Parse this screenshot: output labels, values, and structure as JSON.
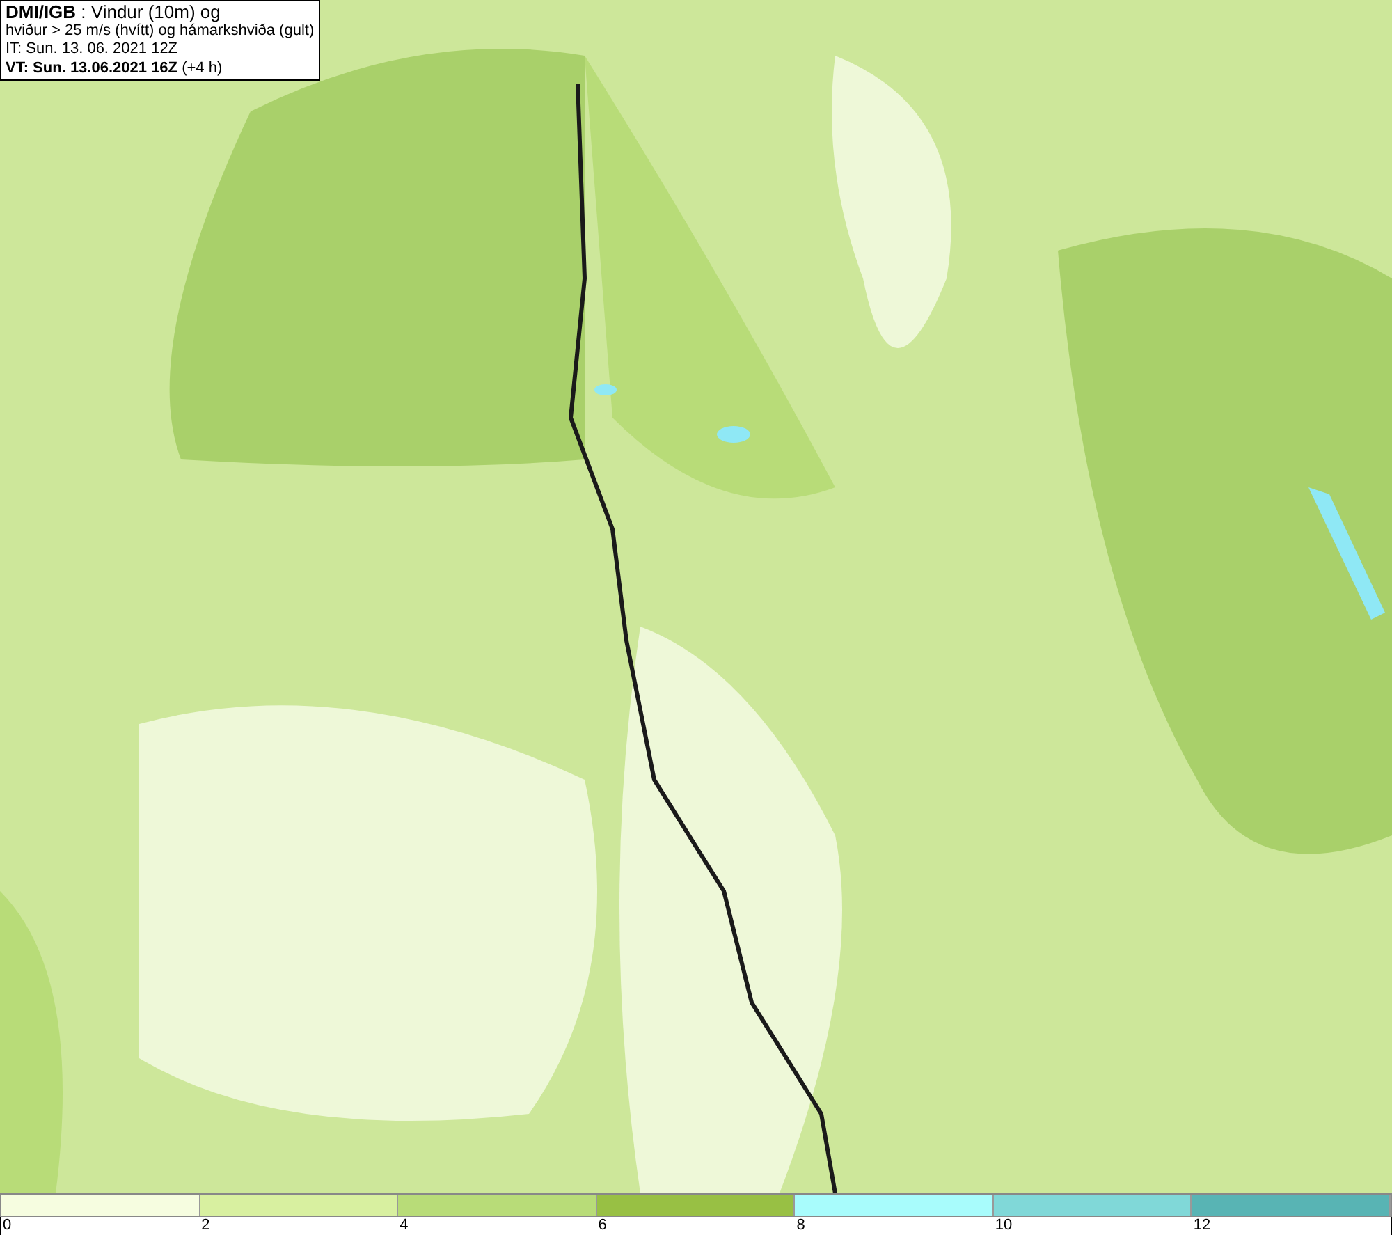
{
  "header": {
    "lines": [
      "**DMI/IGB** : Vindur (10m) og",
      "hviður > 25 m/s (hvítt) og hámarkshviða (gult)",
      "IT: Sun. 13. 06. 2021 12Z",
      "**VT: Sun. 13.06.2021 16Z** (+4 h)"
    ]
  },
  "legend": {
    "bins": [
      {
        "color": "#f6fde0"
      },
      {
        "color": "#d8f0a0"
      },
      {
        "color": "#b8dc78"
      },
      {
        "color": "#98c044"
      },
      {
        "color": "#a8fcfc"
      },
      {
        "color": "#80d8d8"
      },
      {
        "color": "#58b4b4"
      }
    ],
    "ticks": [
      "0",
      "2",
      "4",
      "6",
      "8",
      "10",
      "12"
    ]
  }
}
